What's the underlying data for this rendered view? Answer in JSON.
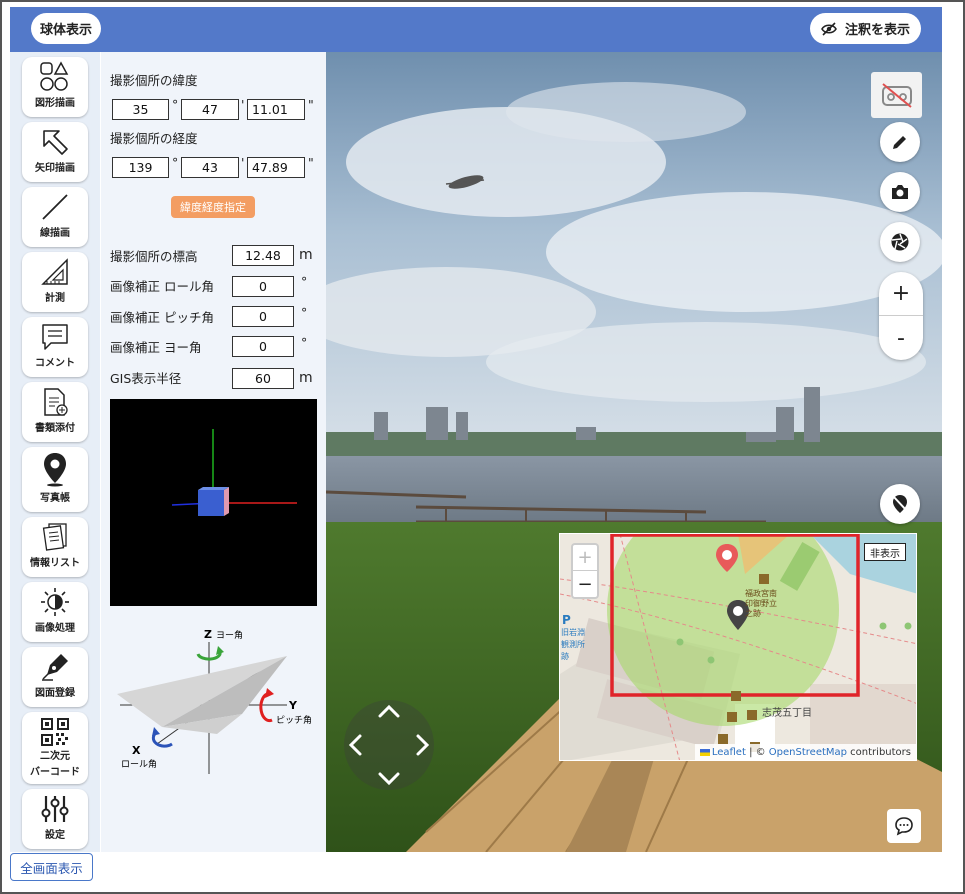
{
  "header": {
    "sphere_button": "球体表示",
    "annotation_button": "注釈を表示"
  },
  "sidebar": {
    "items": [
      {
        "label": "図形描画"
      },
      {
        "label": "矢印描画"
      },
      {
        "label": "線描画"
      },
      {
        "label": "計測"
      },
      {
        "label": "コメント"
      },
      {
        "label": "書類添付"
      },
      {
        "label": "写真帳"
      },
      {
        "label": "情報リスト"
      },
      {
        "label": "画像処理"
      },
      {
        "label": "図面登録"
      },
      {
        "label": "二次元\nバーコード"
      },
      {
        "label": "設定"
      }
    ]
  },
  "panel": {
    "lat_label": "撮影個所の緯度",
    "lat": {
      "deg": "35",
      "min": "47",
      "sec": "11.01"
    },
    "lon_label": "撮影個所の経度",
    "lon": {
      "deg": "139",
      "min": "43",
      "sec": "47.89"
    },
    "deg_sym": "°",
    "min_sym": "'",
    "sec_sym": "\"",
    "latlon_button": "緯度経度指定",
    "elevation_label": "撮影個所の標高",
    "elevation": "12.48",
    "elevation_unit": "m",
    "roll_label": "画像補正 ロール角",
    "roll": "0",
    "pitch_label": "画像補正 ピッチ角",
    "pitch": "0",
    "yaw_label": "画像補正 ヨー角",
    "yaw": "0",
    "angle_unit": "°",
    "gis_label": "GIS表示半径",
    "gis_radius": "60",
    "gis_unit": "m",
    "diagram": {
      "z": "Z",
      "z_label": "ヨー角",
      "y": "Y",
      "y_label": "ピッチ角",
      "x": "X",
      "x_label": "ロール角"
    }
  },
  "map": {
    "zoom_in": "+",
    "zoom_out": "−",
    "hide_button": "非表示",
    "street_label": "志茂五丁目",
    "poi_label": "福政宮南\n印御野立\n之跡",
    "left_labels": "旧岩淵\n観測所\n跡",
    "attribution_leaflet": "Leaflet",
    "attribution_sep": " | © ",
    "attribution_osm": "OpenStreetMap",
    "attribution_tail": " contributors",
    "p_label": "P"
  },
  "viewer_controls": {
    "zoom_in": "+",
    "zoom_out": "-"
  },
  "footer": {
    "fullscreen_button": "全画面表示"
  },
  "colors": {
    "header_blue": "#5379c9",
    "accent_orange": "#f39d62",
    "highlight_red": "#e0242a"
  }
}
